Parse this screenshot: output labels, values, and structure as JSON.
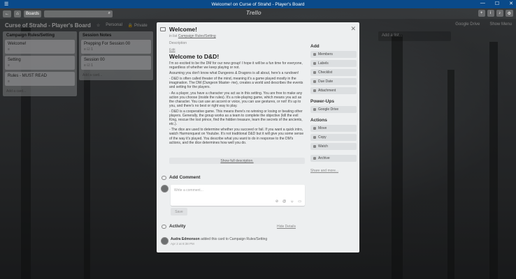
{
  "window": {
    "title": "Welcome! on Curse of Strahd - Player's Board",
    "menu_icon": "hamburger-icon",
    "controls": [
      "—",
      "☐",
      "✕"
    ]
  },
  "header": {
    "back_icon": "back-arrow-icon",
    "home_icon": "home-icon",
    "boards_label": "Boards",
    "search_icon": "search-icon",
    "logo": "Trello",
    "add_icon": "plus-icon",
    "info_icon": "info-icon",
    "bell_icon": "bell-icon",
    "settings_icon": "gear-icon"
  },
  "board": {
    "title": "Curse of Strahd - Player's Board",
    "star_icon": "star-icon",
    "team": "Personal",
    "visibility": "Private",
    "power_up": "Google Drive",
    "show_menu": "Show Menu"
  },
  "lists": [
    {
      "title": "Campaign Rules/Setting",
      "cards": [
        {
          "title": "Welcome!",
          "badge": "≡"
        },
        {
          "title": "Setting",
          "badge": "≡"
        },
        {
          "title": "Rules - MUST READ",
          "badge": "≡"
        }
      ],
      "add_card": "Add a card..."
    },
    {
      "title": "Session Notes",
      "cards": [
        {
          "title": "Prepping For Session 00",
          "badge": "≡  ☑ 1"
        },
        {
          "title": "Session 00",
          "badge": "≡  ☑ 1"
        }
      ],
      "add_card": "Add a card..."
    }
  ],
  "add_list": "Add a list...",
  "modal": {
    "title": "Welcome!",
    "in_list_prefix": "in list",
    "in_list_name": "Campaign Rules/Setting",
    "close_icon": "close-icon",
    "description_label": "Description",
    "edit_label": "Edit",
    "description_heading": "Welcome to D&D!",
    "description_paragraphs": [
      "I'm so excited to be the DM for our new group! I hope it will be a fun time for everyone, regardless of whether we keep playing or not.",
      "Assuming you don't know what Dungeons & Dragons is all about, here's a rundown!",
      "- D&D is often called theater of the mind, meaning it's a game played mostly in the imagination. The DM (Dungeon Master- me), creates a world and describes the events and setting for the players.",
      "- As a player, you have a character you act as in this setting. You are free to make any action you choose (inside the rules). It's a role-playing game, which means you act as the character. You can use an accent or voice, you can use gestures, or not! It's up to you, and there's no best or right way to play.",
      "- D&D is a cooperative game. This means there's no winning or losing or beating other players. Generally, the group works as a team to complete the objective (kill the evil King, rescue the lost prince, find the hidden treasure, learn the secrets of the ancients, etc.).",
      "- The dice are used to determine whether you succeed or fail. If you want a quick intro, watch Harmonquest on Youtube. It's not traditional D&D but it will give you some sense of the way it's played. You describe what you want to do in response to the DM's actions, and the dice determines how well you do."
    ],
    "show_full": "Show full description.",
    "add_comment_label": "Add Comment",
    "comment_placeholder": "Write a comment...",
    "comment_tools": [
      "⊘",
      "@",
      "☺",
      "▭"
    ],
    "save_label": "Save",
    "activity_label": "Activity",
    "hide_details": "Hide Details",
    "activity": {
      "user": "Audra Edmonson",
      "text": "added this card to Campaign Rules/Setting",
      "time": "Apr 2 at 8:38 PM"
    },
    "sidebar": {
      "add_heading": "Add",
      "add_buttons": [
        "Members",
        "Labels",
        "Checklist",
        "Due Date",
        "Attachment"
      ],
      "powerups_heading": "Power-Ups",
      "powerup_buttons": [
        "Google Drive"
      ],
      "actions_heading": "Actions",
      "action_buttons": [
        "Move",
        "Copy",
        "Watch",
        "Archive"
      ],
      "share_label": "Share and more..."
    }
  }
}
